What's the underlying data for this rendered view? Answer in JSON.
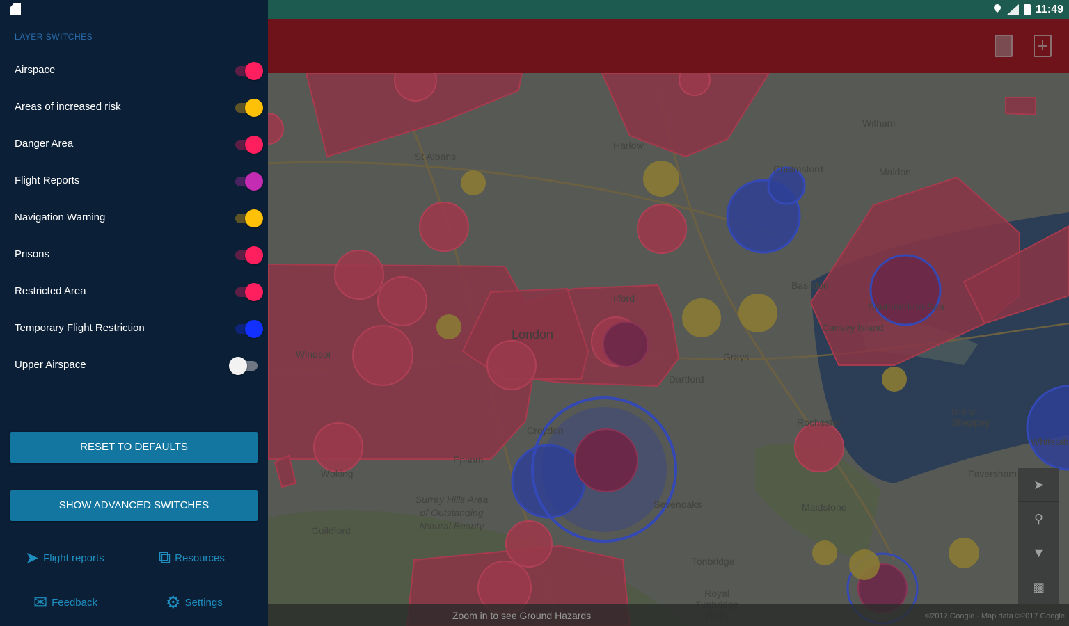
{
  "status_bar": {
    "time": "11:49"
  },
  "sidebar": {
    "section_label": "Layer switches",
    "switches": [
      {
        "label": "Airspace",
        "on": true,
        "color": "#ff1f5f"
      },
      {
        "label": "Areas of increased risk",
        "on": true,
        "color": "#ffc107"
      },
      {
        "label": "Danger Area",
        "on": true,
        "color": "#ff1f5f"
      },
      {
        "label": "Flight Reports",
        "on": true,
        "color": "#c42db3"
      },
      {
        "label": "Navigation Warning",
        "on": true,
        "color": "#ffc107"
      },
      {
        "label": "Prisons",
        "on": true,
        "color": "#ff1f5f"
      },
      {
        "label": "Restricted Area",
        "on": true,
        "color": "#ff1f5f"
      },
      {
        "label": "Temporary Flight Restriction",
        "on": true,
        "color": "#1230ff"
      },
      {
        "label": "Upper Airspace",
        "on": false,
        "color": "#f2f2f2"
      }
    ],
    "reset_button": "Reset to defaults",
    "advanced_button": "Show advanced switches",
    "footer": {
      "flight_reports": "Flight reports",
      "resources": "Resources",
      "feedback": "Feedback",
      "settings": "Settings"
    }
  },
  "map": {
    "places": [
      "St Albans",
      "Harlow",
      "Witham",
      "Chelmsford",
      "Maldon",
      "Basildon",
      "Southend-on-Sea",
      "Canvey Island",
      "London",
      "Ilford",
      "Grays",
      "Dartford",
      "Windsor",
      "Croydon",
      "Epsom",
      "Woking",
      "Guildford",
      "Rochester",
      "Isle of Sheppey",
      "Faversham",
      "Maidstone",
      "Sevenoaks",
      "Tonbridge",
      "Royal Tunbridge Wells",
      "Surrey Hills Area of Outstanding Natural Beauty",
      "Whitstable"
    ],
    "hazard_message": "Zoom in to see Ground Hazards",
    "copyright": "©2017 Google · Map data ©2017 Google",
    "controls": [
      "locate-icon",
      "search-icon",
      "filter-icon",
      "layers-icon"
    ]
  }
}
